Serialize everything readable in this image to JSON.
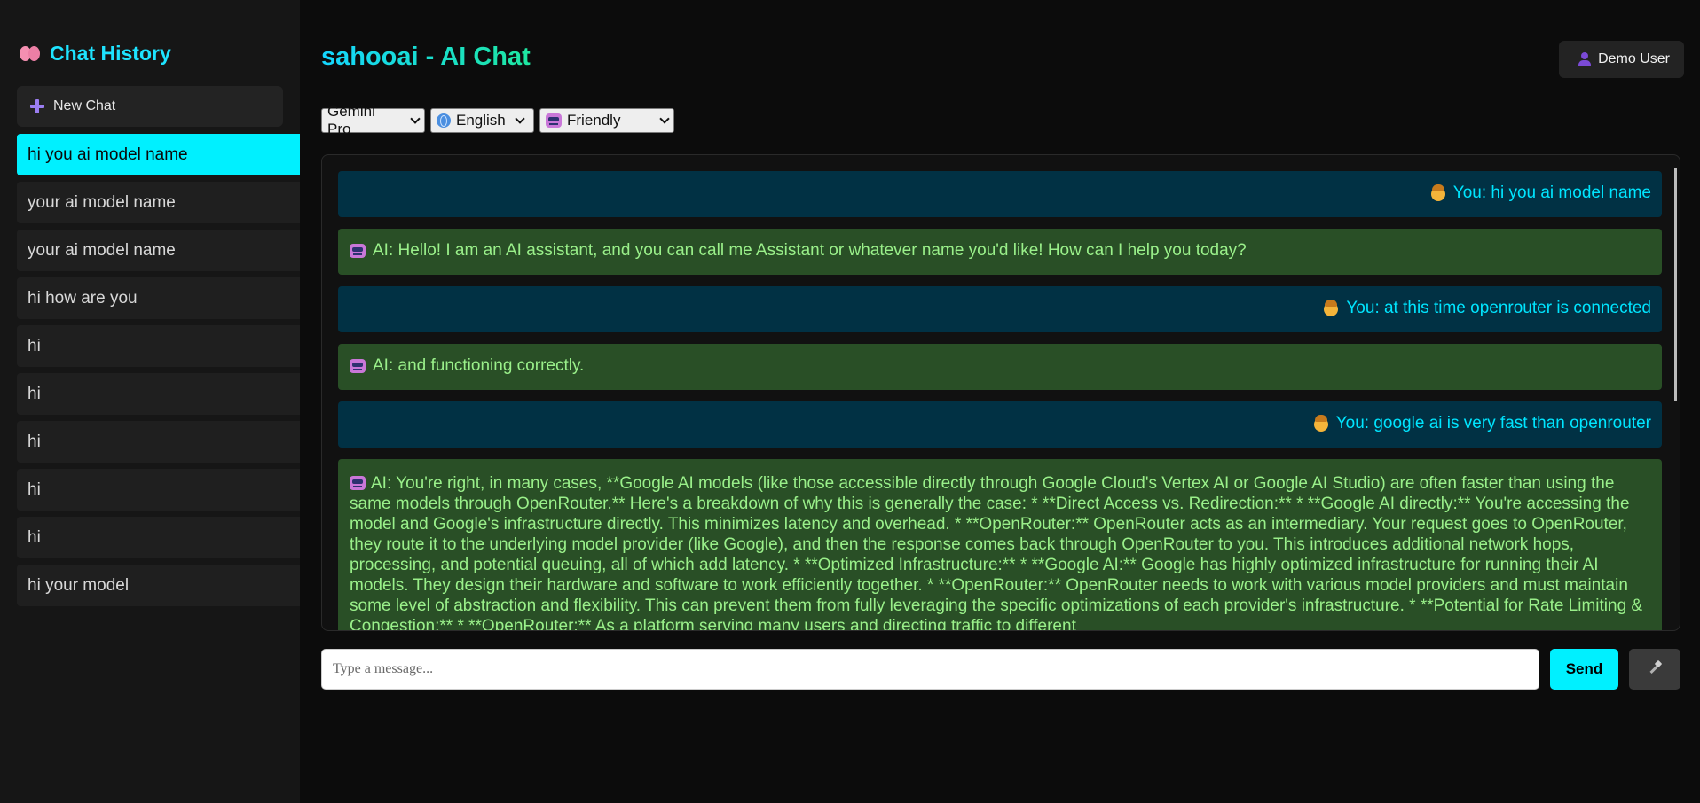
{
  "sidebar": {
    "title": "Chat History",
    "new_chat_label": "New Chat",
    "items": [
      {
        "label": "hi you ai model name",
        "active": true
      },
      {
        "label": "your ai model name",
        "active": false
      },
      {
        "label": "your ai model name",
        "active": false
      },
      {
        "label": "hi how are you",
        "active": false
      },
      {
        "label": "hi",
        "active": false
      },
      {
        "label": "hi",
        "active": false
      },
      {
        "label": "hi",
        "active": false
      },
      {
        "label": "hi",
        "active": false
      },
      {
        "label": "hi",
        "active": false
      },
      {
        "label": "hi your model",
        "active": false
      }
    ]
  },
  "header": {
    "title": "sahooai - AI Chat",
    "user_label": "Demo User"
  },
  "selects": {
    "model": "Gemini Pro",
    "language": "English",
    "tone": "Friendly"
  },
  "messages": [
    {
      "role": "user",
      "text": "You: hi you ai model name"
    },
    {
      "role": "ai",
      "text": "AI: Hello! I am an AI assistant, and you can call me Assistant or whatever name you'd like! How can I help you today?"
    },
    {
      "role": "user",
      "text": "You: at this time openrouter is connected"
    },
    {
      "role": "ai",
      "text": "AI: and functioning correctly."
    },
    {
      "role": "user",
      "text": "You: google ai is very fast than openrouter"
    },
    {
      "role": "ai",
      "text": "AI: You're right, in many cases, **Google AI models (like those accessible directly through Google Cloud's Vertex AI or Google AI Studio) are often faster than using the same models through OpenRouter.** Here's a breakdown of why this is generally the case: * **Direct Access vs. Redirection:** * **Google AI directly:** You're accessing the model and Google's infrastructure directly. This minimizes latency and overhead. * **OpenRouter:** OpenRouter acts as an intermediary. Your request goes to OpenRouter, they route it to the underlying model provider (like Google), and then the response comes back through OpenRouter to you. This introduces additional network hops, processing, and potential queuing, all of which add latency. * **Optimized Infrastructure:** * **Google AI:** Google has highly optimized infrastructure for running their AI models. They design their hardware and software to work efficiently together. * **OpenRouter:** OpenRouter needs to work with various model providers and must maintain some level of abstraction and flexibility. This can prevent them from fully leveraging the specific optimizations of each provider's infrastructure. * **Potential for Rate Limiting & Congestion:** * **OpenRouter:** As a platform serving many users and directing traffic to different"
    }
  ],
  "input": {
    "placeholder": "Type a message...",
    "value": ""
  },
  "send_label": "Send",
  "colors": {
    "accent": "#00f0ff",
    "user_bubble": "#013144",
    "ai_bubble": "#294f26"
  }
}
